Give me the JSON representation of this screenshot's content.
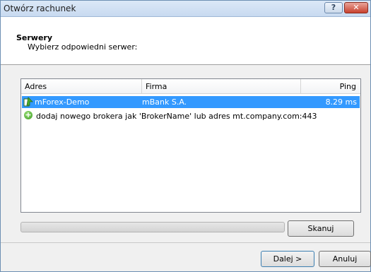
{
  "window": {
    "title": "Otwórz rachunek"
  },
  "titlebar": {
    "help_label": "?",
    "close_label": "✕"
  },
  "header": {
    "title": "Serwery",
    "subtitle": "Wybierz odpowiedni serwer:"
  },
  "columns": [
    "Adres",
    "Firma",
    "Ping"
  ],
  "servers": [
    {
      "address": "mForex-Demo",
      "company": "mBank S.A.",
      "ping": "8.29 ms",
      "selected": true
    }
  ],
  "add_broker": {
    "icon": "add-icon",
    "text": "dodaj nowego brokera jak 'BrokerName' lub adres mt.company.com:443"
  },
  "progress": {
    "value": 0
  },
  "buttons": {
    "scan": "Skanuj",
    "next": "Dalej >",
    "cancel": "Anuluj"
  },
  "colors": {
    "selection": "#3399ff",
    "title_bar": "#c8daf0"
  }
}
